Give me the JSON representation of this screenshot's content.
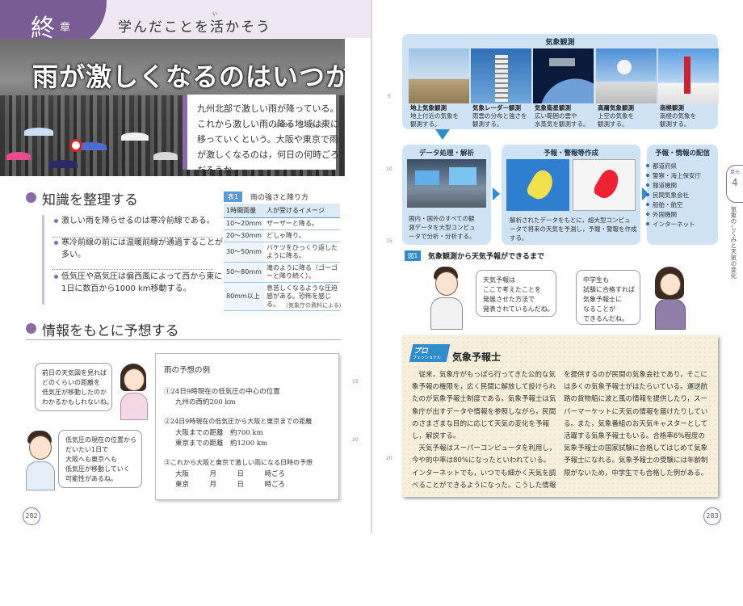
{
  "left": {
    "header": {
      "chapter_kanji": "終",
      "chapter_kanji_sub": "章",
      "title": "学んだことを活かそう",
      "ruby": "い"
    },
    "photo_title": "雨が激しくなるのはいつか",
    "intro_lines": [
      "九州北部で激しい雨が降っている。",
      "これから激しい雨の降る地域は東に",
      "移っていくという。大阪や東京で雨",
      "が激しくなるのは，何日の何時ごろ",
      "だろうか。"
    ],
    "intro_ruby": [
      "おおさか",
      "とうきょう"
    ],
    "knowledge": {
      "heading": "知識を整理する",
      "items": [
        "激しい雨を降らせるのは寒冷前線である。",
        "寒冷前線の前には温暖前線が通過することが多い。",
        "低気圧や高気圧は偏西風によって西から東に1日に数百から1000 km移動する。"
      ]
    },
    "table": {
      "tag": "表1",
      "title": "雨の強さと降り方",
      "headers": [
        "1時間雨量",
        "人が受けるイメージ"
      ],
      "rows": [
        {
          "amount": "10～20mm",
          "image": "ザーザーと降る。"
        },
        {
          "amount": "20～30mm",
          "image": "どしゃ降り。"
        },
        {
          "amount": "30～50mm",
          "image": "バケツをひっくり返したように降る。"
        },
        {
          "amount": "50～80mm",
          "image": "滝のように降る（ゴーゴーと降り続く）。"
        },
        {
          "amount": "80mm以上",
          "image": "息苦しくなるような圧迫感がある。恐怖を感じる。"
        }
      ],
      "source": "（気象庁の資料による）"
    },
    "forecast": {
      "heading": "情報をもとに予想する",
      "bubble_girl": [
        "前日の天気図を見れば",
        "どのくらいの距離を",
        "低気圧が移動したのか",
        "わかるかもしれないね。"
      ],
      "bubble_boy": [
        "低気圧の現在の位置から",
        "だいたい1日で",
        "大阪へも東京へも",
        "低気圧が移動していく",
        "可能性があるね。"
      ],
      "example_title": "雨の予想の例",
      "example_lines": [
        "①24日9時現在の低気圧の中心の位置",
        "九州の西約200 km",
        "②24日9時現在の低気圧から大阪と東京までの距離",
        "大阪までの距離　約700 km",
        "東京までの距離　約1200 km",
        "③これから大阪と東京で激しい雨になる日時の予想",
        "大阪　　　月　　　日　　　時ごろ",
        "東京　　　月　　　日　　　時ごろ"
      ]
    },
    "page_number": "282",
    "margin_numbers": [
      "15",
      "20"
    ]
  },
  "right": {
    "observation": {
      "title": "気象観測",
      "items": [
        {
          "title": "地上気象観測",
          "lines": [
            "地上付近の気象を",
            "観測する。"
          ]
        },
        {
          "title": "気象レーダー観測",
          "lines": [
            "雨雲の分布と強さを",
            "観測する。"
          ]
        },
        {
          "title": "気象衛星観測",
          "lines": [
            "広い範囲の雲や",
            "水蒸気を観測する。"
          ]
        },
        {
          "title": "高層気象観測",
          "lines": [
            "上空の気象を",
            "観測する。"
          ]
        },
        {
          "title": "南極観測",
          "lines": [
            "南極の気象を",
            "観測する。"
          ]
        }
      ]
    },
    "data_processing": {
      "title": "データ処理・解析",
      "lines": [
        "国内・国外のすべての観",
        "測データを大型コンピュ",
        "ータで分析・分析する。"
      ]
    },
    "forecasting": {
      "title": "予報・警報等作成",
      "lines": [
        "解析されたデータをもとに，超大型コンピュ",
        "ータで将来の天気を予測し，予報・警報を作成",
        "する。"
      ]
    },
    "distribution": {
      "title": "予報・情報の配信",
      "items": [
        "都道府県",
        "警察・海上保安庁",
        "報道機関",
        "民間気象会社",
        "船舶・航空",
        "外国機関",
        "インターネット"
      ]
    },
    "figure": {
      "tag": "図1",
      "caption": "気象観測から天気予報ができるまで"
    },
    "bubble_boy": [
      "天気予報は",
      "ここで考えたことを",
      "発展させた方法で",
      "発表されているんだね。"
    ],
    "bubble_girl": [
      "中学生も",
      "試験に合格すれば",
      "気象予報士に",
      "なることが",
      "できるんだね。"
    ],
    "side_tab": {
      "small": "単元",
      "number": "4",
      "vertical": "気象のしくみと天気の変化"
    },
    "pro": {
      "badge": "プロ",
      "badge_sub": "フェッショナル",
      "title": "気象予報士",
      "col1": [
        "　従来，気象庁がもっぱら行ってきた公的な気",
        "象予報の権限を，広く民間に解放して設けられ",
        "たのが気象予報士制度である。気象予報士は気",
        "象庁が出すデータや情報を参照しながら，民間",
        "のさまざまな目的に応じて天気の変化を予報",
        "し，解説する。",
        "　天気予報はスーパーコンピュータを利用し，",
        "今や的中率は80%になったといわれている。",
        "インターネットでも，いつでも細かく天気を調",
        "べることができるようになった。こうした情報"
      ],
      "col2": [
        "を提供するのが民間の気象会社であり，そこに",
        "は多くの気象予報士がはたらいている。運送航",
        "路の貨物船に波と風の情報を提供したり，スー",
        "パーマーケットに天気の情報を届けたりしてい",
        "る。また，気象番組のお天気キャスターとして",
        "活躍する気象予報士もいる。合格率6%程度の",
        "気象予報士の国家試験に合格してはじめて気象",
        "予報士になれる。気象予報士の受験には年齢制",
        "限がないため，中学生でも合格した例がある。"
      ]
    },
    "page_number": "283",
    "margin_numbers": [
      "5",
      "10",
      "15",
      "20"
    ]
  }
}
